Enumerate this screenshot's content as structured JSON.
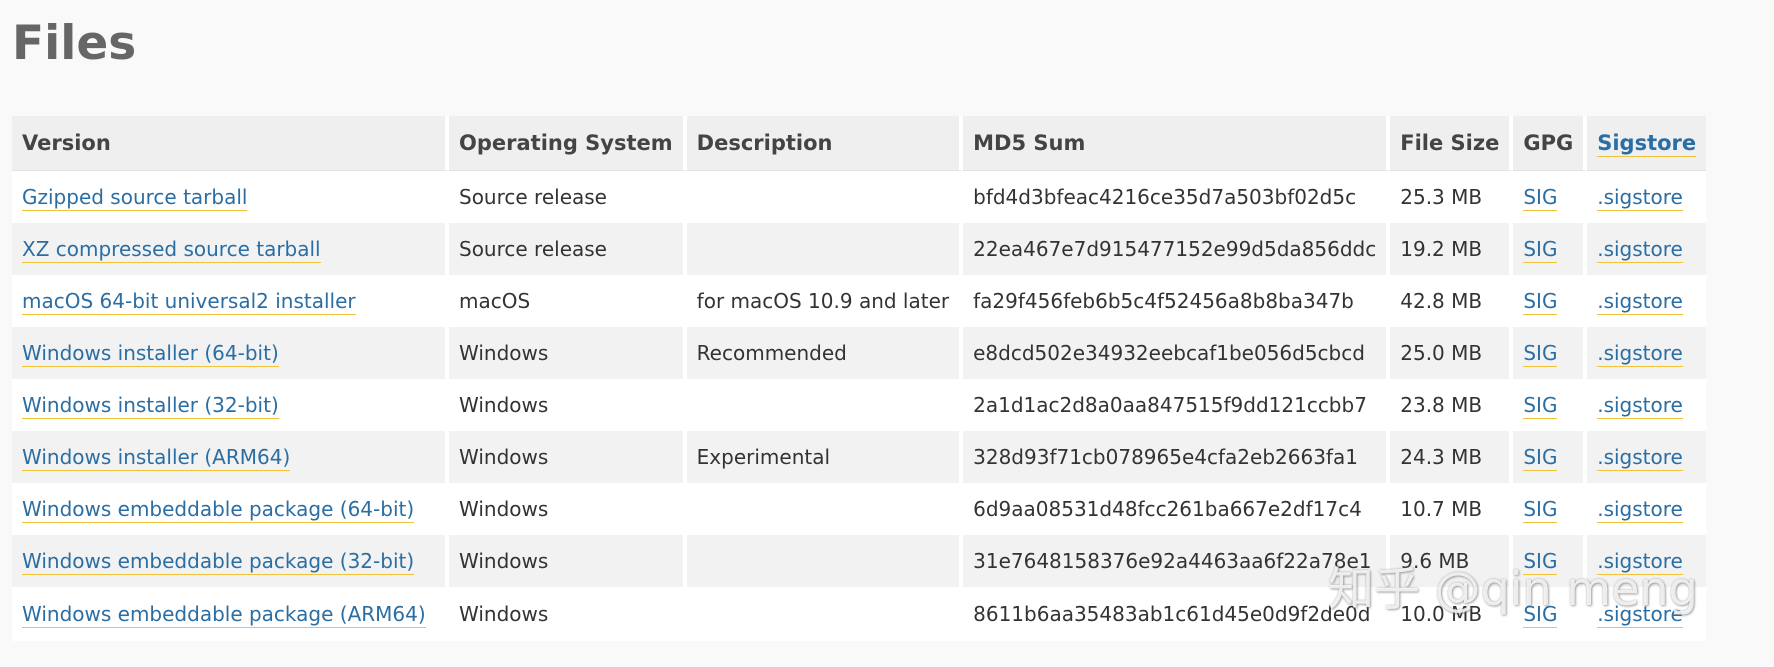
{
  "page": {
    "title": "Files"
  },
  "table": {
    "headers": {
      "version": "Version",
      "os": "Operating System",
      "description": "Description",
      "md5": "MD5 Sum",
      "size": "File Size",
      "gpg": "GPG",
      "sigstore": "Sigstore"
    },
    "rows": [
      {
        "version": "Gzipped source tarball",
        "os": "Source release",
        "description": "",
        "md5": "bfd4d3bfeac4216ce35d7a503bf02d5c",
        "size": "25.3 MB",
        "gpg": "SIG",
        "sigstore": ".sigstore"
      },
      {
        "version": "XZ compressed source tarball",
        "os": "Source release",
        "description": "",
        "md5": "22ea467e7d915477152e99d5da856ddc",
        "size": "19.2 MB",
        "gpg": "SIG",
        "sigstore": ".sigstore"
      },
      {
        "version": "macOS 64-bit universal2 installer",
        "os": "macOS",
        "description": "for macOS 10.9 and later",
        "md5": "fa29f456feb6b5c4f52456a8b8ba347b",
        "size": "42.8 MB",
        "gpg": "SIG",
        "sigstore": ".sigstore"
      },
      {
        "version": "Windows installer (64-bit)",
        "os": "Windows",
        "description": "Recommended",
        "md5": "e8dcd502e34932eebcaf1be056d5cbcd",
        "size": "25.0 MB",
        "gpg": "SIG",
        "sigstore": ".sigstore"
      },
      {
        "version": "Windows installer (32-bit)",
        "os": "Windows",
        "description": "",
        "md5": "2a1d1ac2d8a0aa847515f9dd121ccbb7",
        "size": "23.8 MB",
        "gpg": "SIG",
        "sigstore": ".sigstore"
      },
      {
        "version": "Windows installer (ARM64)",
        "os": "Windows",
        "description": "Experimental",
        "md5": "328d93f71cb078965e4cfa2eb2663fa1",
        "size": "24.3 MB",
        "gpg": "SIG",
        "sigstore": ".sigstore"
      },
      {
        "version": "Windows embeddable package (64-bit)",
        "os": "Windows",
        "description": "",
        "md5": "6d9aa08531d48fcc261ba667e2df17c4",
        "size": "10.7 MB",
        "gpg": "SIG",
        "sigstore": ".sigstore"
      },
      {
        "version": "Windows embeddable package (32-bit)",
        "os": "Windows",
        "description": "",
        "md5": "31e7648158376e92a4463aa6f22a78e1",
        "size": "9.6 MB",
        "gpg": "SIG",
        "sigstore": ".sigstore"
      },
      {
        "version": "Windows embeddable package (ARM64)",
        "os": "Windows",
        "description": "",
        "md5": "8611b6aa35483ab1c61d45e0d9f2de0d",
        "size": "10.0 MB",
        "gpg": "SIG",
        "sigstore": ".sigstore"
      }
    ]
  },
  "watermark": {
    "text": "知乎 @qin meng"
  },
  "colors": {
    "link": "#2b6ea3",
    "link_underline": "#f0c33a",
    "header_bg": "#efefef",
    "row_alt_bg": "#f2f2f2",
    "title": "#666666"
  }
}
